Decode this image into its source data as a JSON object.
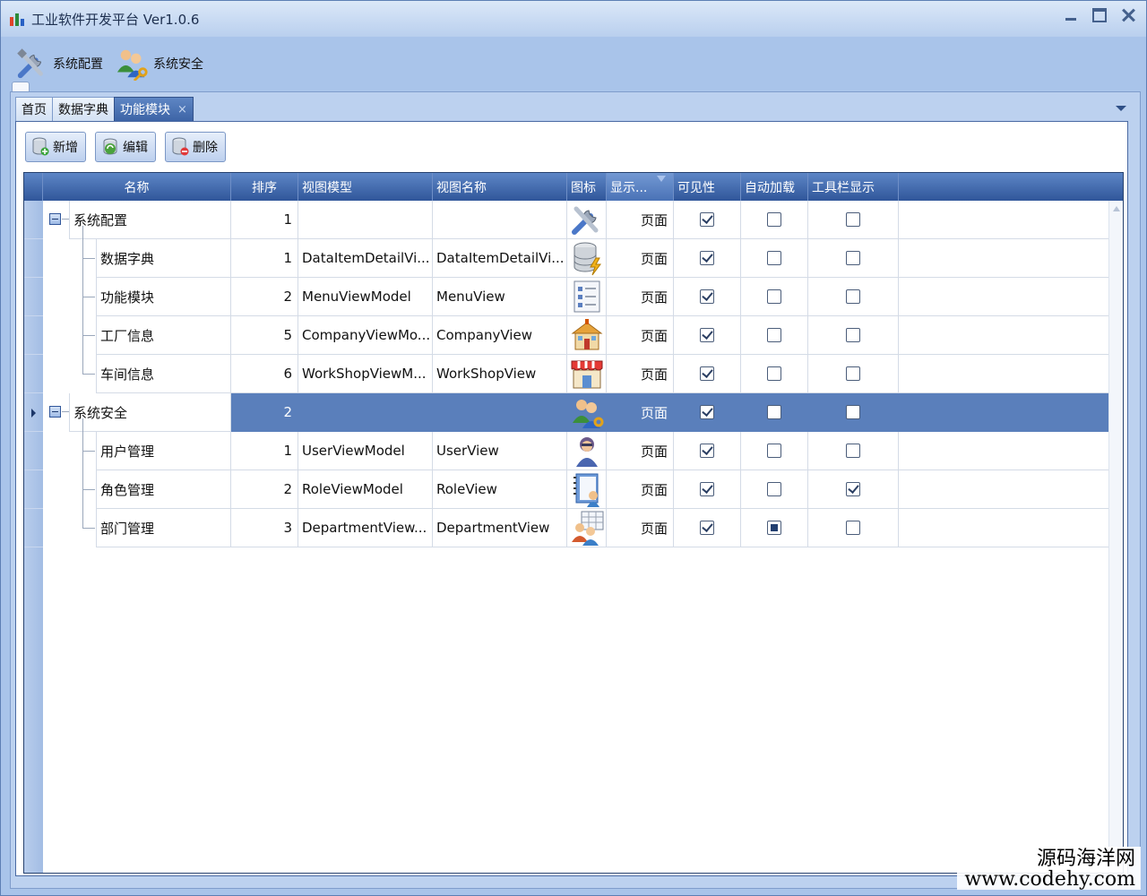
{
  "window": {
    "title": "工业软件开发平台 Ver1.0.6"
  },
  "ribbon": {
    "items": [
      {
        "label": "系统配置",
        "icon": "tools-icon"
      },
      {
        "label": "系统安全",
        "icon": "users-key-icon"
      }
    ]
  },
  "tabs": [
    {
      "label": "首页"
    },
    {
      "label": "数据字典"
    },
    {
      "label": "功能模块",
      "active": true,
      "close": "×"
    }
  ],
  "toolbar": {
    "add_label": "新增",
    "edit_label": "编辑",
    "delete_label": "删除"
  },
  "grid": {
    "columns": {
      "name": "名称",
      "order": "排序",
      "view_model": "视图模型",
      "view_name": "视图名称",
      "icon": "图标",
      "display": "显示...",
      "visible": "可见性",
      "auto_load": "自动加载",
      "toolbar_show": "工具栏显示"
    },
    "rows": [
      {
        "name": "系统配置",
        "order": "1",
        "view_model": "",
        "view_name": "",
        "icon": "tools-icon",
        "display": "页面",
        "visible": true,
        "auto_load": false,
        "toolbar_show": false,
        "level": 0,
        "expanded": true
      },
      {
        "name": "数据字典",
        "order": "1",
        "view_model": "DataItemDetailVi...",
        "view_name": "DataItemDetailVi...",
        "icon": "database-icon",
        "display": "页面",
        "visible": true,
        "auto_load": false,
        "toolbar_show": false,
        "level": 1
      },
      {
        "name": "功能模块",
        "order": "2",
        "view_model": "MenuViewModel",
        "view_name": "MenuView",
        "icon": "menu-list-icon",
        "display": "页面",
        "visible": true,
        "auto_load": false,
        "toolbar_show": false,
        "level": 1
      },
      {
        "name": "工厂信息",
        "order": "5",
        "view_model": "CompanyViewMo...",
        "view_name": "CompanyView",
        "icon": "factory-icon",
        "display": "页面",
        "visible": true,
        "auto_load": false,
        "toolbar_show": false,
        "level": 1
      },
      {
        "name": "车间信息",
        "order": "6",
        "view_model": "WorkShopViewM...",
        "view_name": "WorkShopView",
        "icon": "shop-icon",
        "display": "页面",
        "visible": true,
        "auto_load": false,
        "toolbar_show": false,
        "level": 1
      },
      {
        "name": "系统安全",
        "order": "2",
        "view_model": "",
        "view_name": "",
        "icon": "users-key-icon",
        "display": "页面",
        "visible": true,
        "auto_load": false,
        "toolbar_show": false,
        "level": 0,
        "expanded": true,
        "selected": true
      },
      {
        "name": "用户管理",
        "order": "1",
        "view_model": "UserViewModel",
        "view_name": "UserView",
        "icon": "user-icon",
        "display": "页面",
        "visible": true,
        "auto_load": false,
        "toolbar_show": false,
        "level": 1
      },
      {
        "name": "角色管理",
        "order": "2",
        "view_model": "RoleViewModel",
        "view_name": "RoleView",
        "icon": "role-book-icon",
        "display": "页面",
        "visible": true,
        "auto_load": false,
        "toolbar_show": true,
        "level": 1
      },
      {
        "name": "部门管理",
        "order": "3",
        "view_model": "DepartmentView...",
        "view_name": "DepartmentView",
        "icon": "department-icon",
        "display": "页面",
        "visible": true,
        "auto_load": "indeterminate",
        "toolbar_show": false,
        "level": 1
      }
    ]
  },
  "watermark": {
    "line1": "源码海洋网",
    "line2": "www.codehy.com"
  },
  "colors": {
    "header": "#30569a",
    "selected_row": "#5a7fbb",
    "frame": "#a9c4ea"
  }
}
